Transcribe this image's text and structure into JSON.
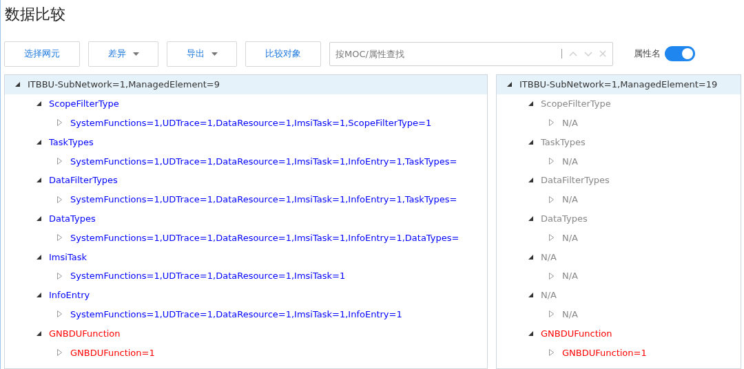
{
  "page": {
    "title": "数据比较"
  },
  "toolbar": {
    "buttons": [
      {
        "label": "选择网元",
        "dropdown": false
      },
      {
        "label": "差异",
        "dropdown": true
      },
      {
        "label": "导出",
        "dropdown": true
      },
      {
        "label": "比较对象",
        "dropdown": false
      }
    ],
    "search": {
      "placeholder": "按MOC/属性查找"
    },
    "toggle": {
      "label": "属性名",
      "on": true
    }
  },
  "panels": [
    {
      "tree": [
        {
          "label": "ITBBU-SubNetwork=1,ManagedElement=9",
          "color": "#333333",
          "expanded": true,
          "selected": true,
          "children": [
            {
              "label": "ScopeFilterType",
              "color": "#0000ff",
              "expanded": true,
              "selected": false,
              "children": [
                {
                  "label": "SystemFunctions=1,UDTrace=1,DataResource=1,ImsiTask=1,ScopeFilterType=1",
                  "color": "#0000ff",
                  "expanded": false,
                  "selected": false
                }
              ]
            },
            {
              "label": "TaskTypes",
              "color": "#0000ff",
              "expanded": true,
              "selected": false,
              "children": [
                {
                  "label": "SystemFunctions=1,UDTrace=1,DataResource=1,ImsiTask=1,InfoEntry=1,TaskTypes=",
                  "color": "#0000ff",
                  "expanded": false,
                  "selected": false
                }
              ]
            },
            {
              "label": "DataFilterTypes",
              "color": "#0000ff",
              "expanded": true,
              "selected": false,
              "children": [
                {
                  "label": "SystemFunctions=1,UDTrace=1,DataResource=1,ImsiTask=1,InfoEntry=1,TaskTypes=",
                  "color": "#0000ff",
                  "expanded": false,
                  "selected": false
                }
              ]
            },
            {
              "label": "DataTypes",
              "color": "#0000ff",
              "expanded": true,
              "selected": false,
              "children": [
                {
                  "label": "SystemFunctions=1,UDTrace=1,DataResource=1,ImsiTask=1,InfoEntry=1,DataTypes=",
                  "color": "#0000ff",
                  "expanded": false,
                  "selected": false
                }
              ]
            },
            {
              "label": "ImsiTask",
              "color": "#0000ff",
              "expanded": true,
              "selected": false,
              "children": [
                {
                  "label": "SystemFunctions=1,UDTrace=1,DataResource=1,ImsiTask=1",
                  "color": "#0000ff",
                  "expanded": false,
                  "selected": false
                }
              ]
            },
            {
              "label": "InfoEntry",
              "color": "#0000ff",
              "expanded": true,
              "selected": false,
              "children": [
                {
                  "label": "SystemFunctions=1,UDTrace=1,DataResource=1,ImsiTask=1,InfoEntry=1",
                  "color": "#0000ff",
                  "expanded": false,
                  "selected": false
                }
              ]
            },
            {
              "label": "GNBDUFunction",
              "color": "#ff0000",
              "expanded": true,
              "selected": false,
              "children": [
                {
                  "label": "GNBDUFunction=1",
                  "color": "#ff0000",
                  "expanded": false,
                  "selected": false
                }
              ]
            }
          ]
        }
      ]
    },
    {
      "tree": [
        {
          "label": "ITBBU-SubNetwork=1,ManagedElement=19",
          "color": "#333333",
          "expanded": true,
          "selected": true,
          "children": [
            {
              "label": "ScopeFilterType",
              "color": "#888888",
              "expanded": true,
              "selected": false,
              "children": [
                {
                  "label": "N/A",
                  "color": "#888888",
                  "expanded": false,
                  "selected": false
                }
              ]
            },
            {
              "label": "TaskTypes",
              "color": "#888888",
              "expanded": true,
              "selected": false,
              "children": [
                {
                  "label": "N/A",
                  "color": "#888888",
                  "expanded": false,
                  "selected": false
                }
              ]
            },
            {
              "label": "DataFilterTypes",
              "color": "#888888",
              "expanded": true,
              "selected": false,
              "children": [
                {
                  "label": "N/A",
                  "color": "#888888",
                  "expanded": false,
                  "selected": false
                }
              ]
            },
            {
              "label": "DataTypes",
              "color": "#888888",
              "expanded": true,
              "selected": false,
              "children": [
                {
                  "label": "N/A",
                  "color": "#888888",
                  "expanded": false,
                  "selected": false
                }
              ]
            },
            {
              "label": "N/A",
              "color": "#888888",
              "expanded": true,
              "selected": false,
              "children": [
                {
                  "label": "N/A",
                  "color": "#888888",
                  "expanded": false,
                  "selected": false
                }
              ]
            },
            {
              "label": "N/A",
              "color": "#888888",
              "expanded": true,
              "selected": false,
              "children": [
                {
                  "label": "N/A",
                  "color": "#888888",
                  "expanded": false,
                  "selected": false
                }
              ]
            },
            {
              "label": "GNBDUFunction",
              "color": "#ff0000",
              "expanded": true,
              "selected": false,
              "children": [
                {
                  "label": "GNBDUFunction=1",
                  "color": "#ff0000",
                  "expanded": false,
                  "selected": false
                }
              ]
            }
          ]
        }
      ]
    }
  ]
}
